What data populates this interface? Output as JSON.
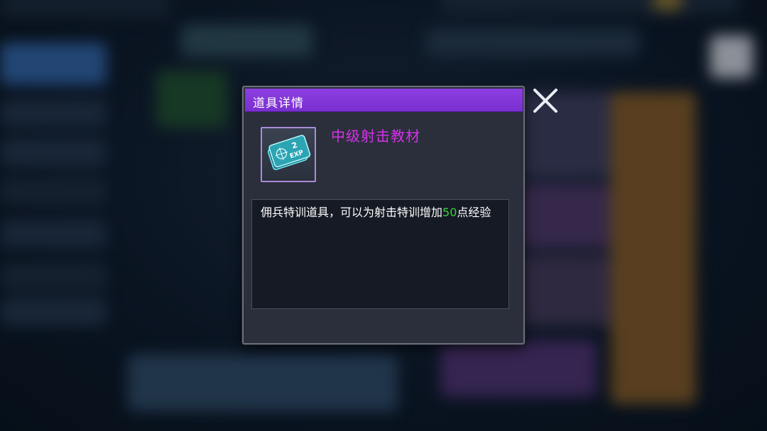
{
  "dialog": {
    "title": "道具详情",
    "item_name": "中级射击教材",
    "item_icon": "exp-card-icon",
    "item_icon_badge": "2",
    "item_icon_text": "EXP",
    "description_before": "佣兵特训道具，可以为射击特训增加",
    "description_number": "50",
    "description_after": "点经验"
  },
  "colors": {
    "header": "#8c3fe0",
    "item_name": "#d531e8",
    "highlight_number": "#39d43a"
  }
}
